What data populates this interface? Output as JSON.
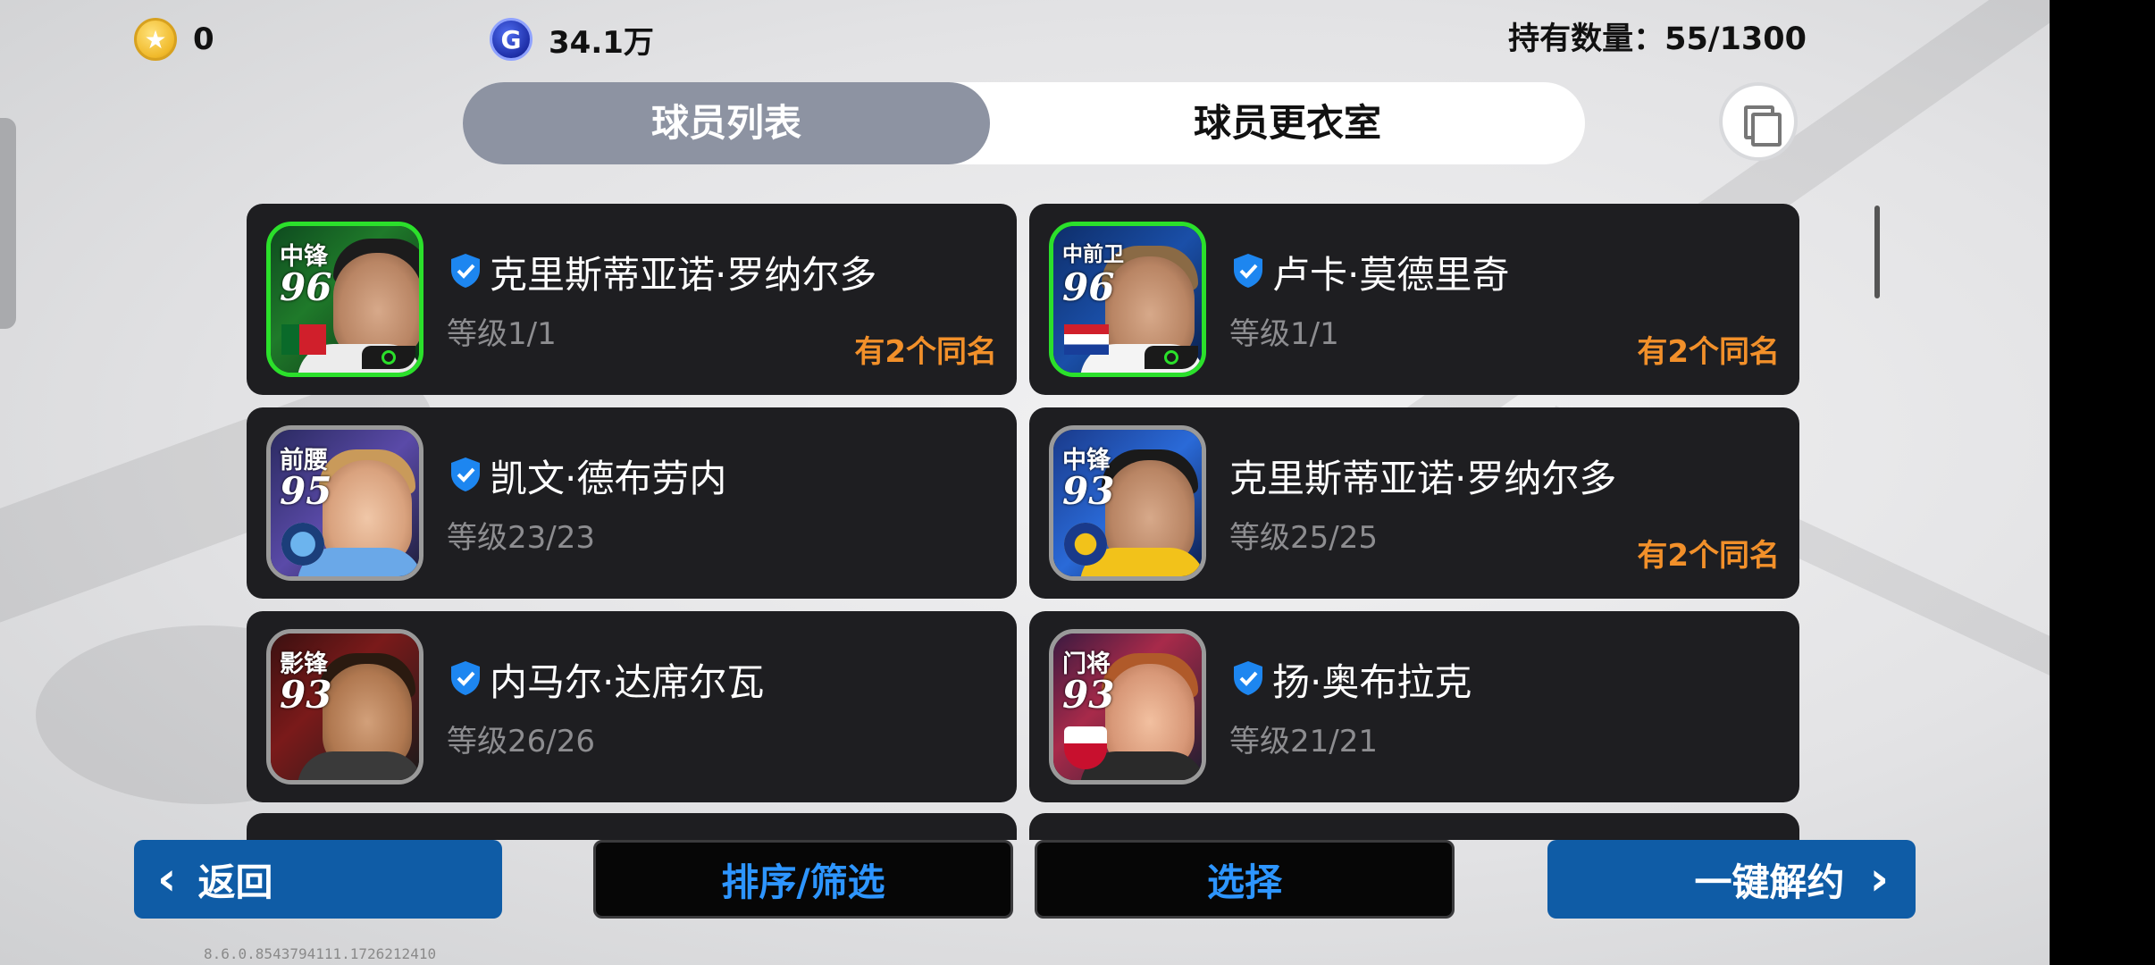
{
  "currency": {
    "gold": {
      "icon": "star-coin-icon",
      "value": "0"
    },
    "gp": {
      "icon": "g-coin-icon",
      "symbol": "G",
      "value": "34.1万"
    },
    "holding": "持有数量：55/1300"
  },
  "tabs": [
    {
      "label": "球员列表",
      "active": true
    },
    {
      "label": "球员更衣室",
      "active": false
    }
  ],
  "players": [
    {
      "position": "中锋",
      "rating": "96",
      "name": "克里斯蒂亚诺·罗纳尔多",
      "level": "等级1/1",
      "duplicate": "有2个同名",
      "verified": true,
      "special": true
    },
    {
      "position": "中前卫",
      "rating": "96",
      "name": "卢卡·莫德里奇",
      "level": "等级1/1",
      "duplicate": "有2个同名",
      "verified": true,
      "special": true
    },
    {
      "position": "前腰",
      "rating": "95",
      "name": "凯文·德布劳内",
      "level": "等级23/23",
      "duplicate": "",
      "verified": true,
      "special": false
    },
    {
      "position": "中锋",
      "rating": "93",
      "name": "克里斯蒂亚诺·罗纳尔多",
      "level": "等级25/25",
      "duplicate": "有2个同名",
      "verified": false,
      "special": false
    },
    {
      "position": "影锋",
      "rating": "93",
      "name": "内马尔·达席尔瓦",
      "level": "等级26/26",
      "duplicate": "",
      "verified": true,
      "special": false
    },
    {
      "position": "门将",
      "rating": "93",
      "name": "扬·奥布拉克",
      "level": "等级21/21",
      "duplicate": "",
      "verified": true,
      "special": false
    }
  ],
  "buttons": {
    "back": "返回",
    "sort_filter": "排序/筛选",
    "select": "选择",
    "release_all": "一键解约"
  },
  "version": "8.6.0.8543794111.1726212410",
  "colors": {
    "tab_active": "#8d93a2",
    "card_bg": "#1e1e21",
    "duplicate_text": "#f2902a",
    "button_blue": "#0f5ca6",
    "button_text_blue": "#2d95ff",
    "special_border": "#2be02b"
  }
}
